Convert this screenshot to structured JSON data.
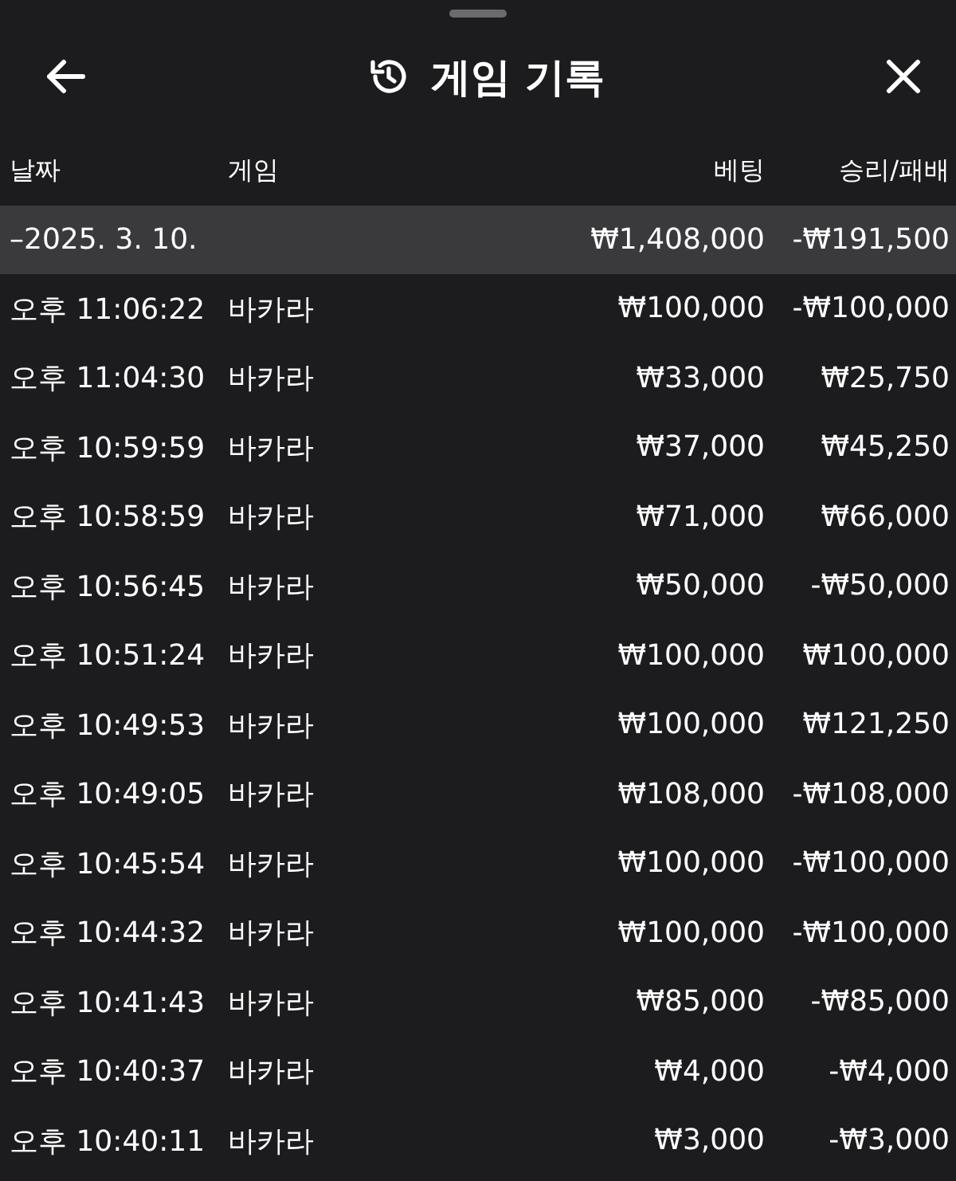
{
  "header": {
    "title": "게임 기록"
  },
  "columns": [
    "날짜",
    "게임",
    "베팅",
    "승리/패배"
  ],
  "group": {
    "date": "–2025. 3. 10.",
    "bet": "₩1,408,000",
    "result": "-₩191,500"
  },
  "rows": [
    {
      "time": "오후 11:06:22",
      "game": "바카라",
      "bet": "₩100,000",
      "result": "-₩100,000"
    },
    {
      "time": "오후 11:04:30",
      "game": "바카라",
      "bet": "₩33,000",
      "result": "₩25,750"
    },
    {
      "time": "오후 10:59:59",
      "game": "바카라",
      "bet": "₩37,000",
      "result": "₩45,250"
    },
    {
      "time": "오후 10:58:59",
      "game": "바카라",
      "bet": "₩71,000",
      "result": "₩66,000"
    },
    {
      "time": "오후 10:56:45",
      "game": "바카라",
      "bet": "₩50,000",
      "result": "-₩50,000"
    },
    {
      "time": "오후 10:51:24",
      "game": "바카라",
      "bet": "₩100,000",
      "result": "₩100,000"
    },
    {
      "time": "오후 10:49:53",
      "game": "바카라",
      "bet": "₩100,000",
      "result": "₩121,250"
    },
    {
      "time": "오후 10:49:05",
      "game": "바카라",
      "bet": "₩108,000",
      "result": "-₩108,000"
    },
    {
      "time": "오후 10:45:54",
      "game": "바카라",
      "bet": "₩100,000",
      "result": "-₩100,000"
    },
    {
      "time": "오후 10:44:32",
      "game": "바카라",
      "bet": "₩100,000",
      "result": "-₩100,000"
    },
    {
      "time": "오후 10:41:43",
      "game": "바카라",
      "bet": "₩85,000",
      "result": "-₩85,000"
    },
    {
      "time": "오후 10:40:37",
      "game": "바카라",
      "bet": "₩4,000",
      "result": "-₩4,000"
    },
    {
      "time": "오후 10:40:11",
      "game": "바카라",
      "bet": "₩3,000",
      "result": "-₩3,000"
    }
  ]
}
